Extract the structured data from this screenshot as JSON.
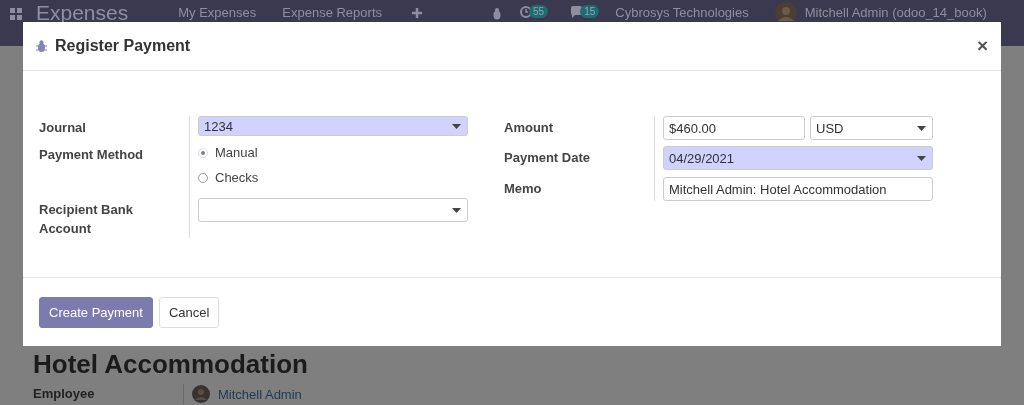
{
  "navbar": {
    "app": "Expenses",
    "menu": [
      "My Expenses",
      "Expense Reports"
    ],
    "activity_count": "55",
    "message_count": "15",
    "company": "Cybrosys Technologies",
    "user": "Mitchell Admin (odoo_14_book)"
  },
  "form": {
    "title": "Hotel Accommodation",
    "fields": [
      {
        "label": "Employee",
        "value": "Mitchell Admin"
      }
    ]
  },
  "dialog": {
    "title": "Register Payment",
    "close": "×",
    "left_fields": [
      {
        "kind": "select",
        "label": "Journal",
        "value": "1234",
        "required": true
      },
      {
        "kind": "radio",
        "label": "Payment Method",
        "options": [
          {
            "label": "Manual",
            "selected": true
          },
          {
            "label": "Checks",
            "selected": false
          }
        ]
      },
      {
        "kind": "select",
        "label": "Recipient Bank Account",
        "required": false
      }
    ],
    "right_fields": [
      {
        "kind": "amount",
        "label": "Amount",
        "value": "$460.00",
        "currency": "USD"
      },
      {
        "kind": "select",
        "label": "Payment Date",
        "value": "04/29/2021",
        "required": true
      },
      {
        "kind": "text",
        "label": "Memo",
        "value": "Mitchell Admin: Hotel Accommodation"
      }
    ],
    "buttons": [
      {
        "label": "Create Payment",
        "primary": true
      },
      {
        "label": "Cancel",
        "primary": false
      }
    ]
  }
}
